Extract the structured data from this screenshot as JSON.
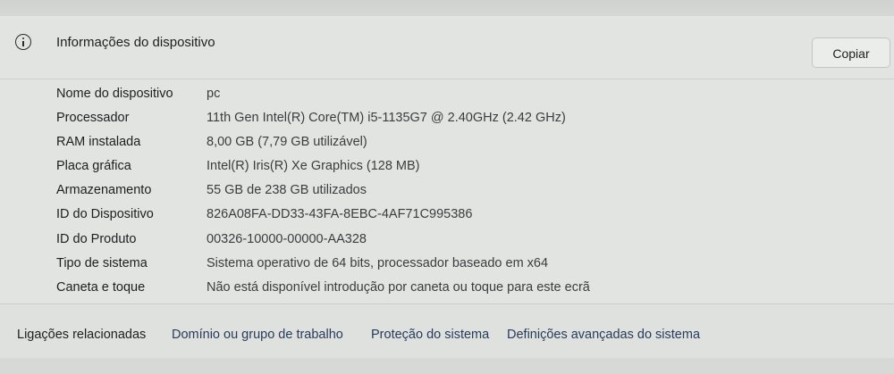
{
  "header": {
    "title": "Informações do dispositivo",
    "copy_label": "Copiar",
    "icon": "info-icon"
  },
  "specs": [
    {
      "label": "Nome do dispositivo",
      "value": "pc"
    },
    {
      "label": "Processador",
      "value": "11th Gen Intel(R) Core(TM) i5-1135G7 @ 2.40GHz (2.42 GHz)"
    },
    {
      "label": "RAM instalada",
      "value": "8,00 GB (7,79 GB utilizável)"
    },
    {
      "label": "Placa gráfica",
      "value": "Intel(R) Iris(R) Xe Graphics (128 MB)"
    },
    {
      "label": "Armazenamento",
      "value": "55 GB de 238 GB utilizados"
    },
    {
      "label": "ID do Dispositivo",
      "value": "826A08FA-DD33-43FA-8EBC-4AF71C995386"
    },
    {
      "label": "ID do Produto",
      "value": "00326-10000-00000-AA328"
    },
    {
      "label": "Tipo de sistema",
      "value": "Sistema operativo de 64 bits, processador baseado em x64"
    },
    {
      "label": "Caneta e toque",
      "value": "Não está disponível introdução por caneta ou toque para este ecrã"
    }
  ],
  "related": {
    "title": "Ligações relacionadas",
    "links": [
      "Domínio ou grupo de trabalho",
      "Proteção do sistema",
      "Definições avançadas do sistema"
    ]
  },
  "colors": {
    "background": "#e2e4e1",
    "link": "#283b5a"
  }
}
